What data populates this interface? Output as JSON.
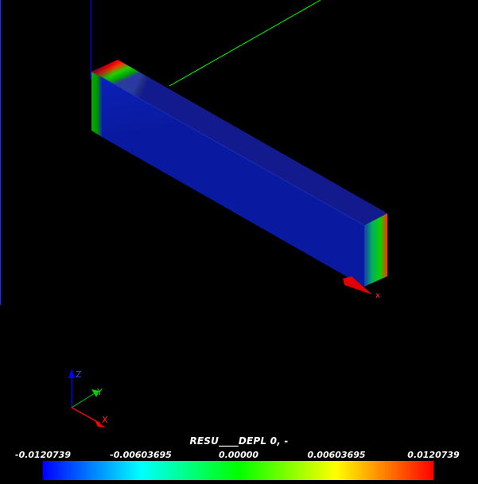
{
  "legend": {
    "title": "RESU____DEPL 0, -",
    "ticks": [
      "-0.0120739",
      "-0.00603695",
      "0.00000",
      "0.00603695",
      "0.0120739"
    ],
    "gradient_colors": [
      "#0000ff",
      "#00ffff",
      "#00ff00",
      "#ffff00",
      "#ff0000"
    ]
  },
  "axes": {
    "main_x_label": "x",
    "triad_labels": {
      "x": "X",
      "y": "Y",
      "z": "Z"
    },
    "colors": {
      "x": "#ff0000",
      "y": "#00ff00",
      "z": "#0000ff"
    }
  },
  "icons": {
    "main_x_arrow": "cone-arrow-icon",
    "triad": "axes-triad-icon"
  }
}
